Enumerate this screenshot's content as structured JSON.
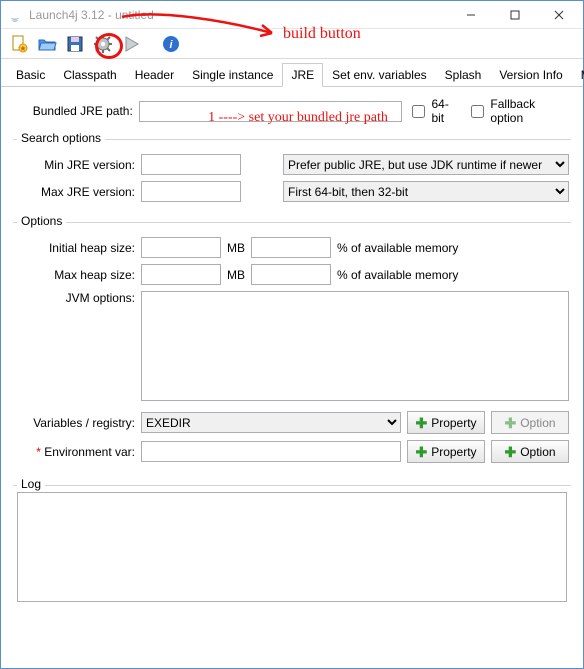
{
  "window": {
    "title": "Launch4j 3.12 - untitled"
  },
  "toolbar_icons": {
    "new": "new-file-icon",
    "open": "open-folder-icon",
    "save": "save-icon",
    "build": "gear-icon",
    "run": "play-icon",
    "info": "info-icon"
  },
  "tabs": [
    "Basic",
    "Classpath",
    "Header",
    "Single instance",
    "JRE",
    "Set env. variables",
    "Splash",
    "Version Info",
    "Messages"
  ],
  "active_tab": "JRE",
  "jre": {
    "bundled_label": "Bundled JRE path:",
    "bundled_value": "",
    "sixtyfour_label": "64-bit",
    "fallback_label": "Fallback option",
    "search_legend": "Search options",
    "min_label": "Min JRE version:",
    "min_value": "",
    "max_label": "Max JRE version:",
    "max_value": "",
    "pref_dropdown": "Prefer public JRE, but use JDK runtime if newer",
    "arch_dropdown": "First 64-bit, then 32-bit",
    "options_legend": "Options",
    "init_heap_label": "Initial heap size:",
    "init_heap_value": "",
    "init_heap_pct_value": "",
    "max_heap_label": "Max heap size:",
    "max_heap_value": "",
    "max_heap_pct_value": "",
    "mb": "MB",
    "pct_label": "% of available memory",
    "jvm_label": "JVM options:",
    "jvm_value": "",
    "vars_label": "Variables / registry:",
    "vars_value": "EXEDIR",
    "env_label": "* Environment var:",
    "env_value": "",
    "property_btn": "Property",
    "option_btn": "Option",
    "log_legend": "Log"
  },
  "annotations": {
    "build": "build button",
    "bundled": "1 ---->  set your bundled jre path"
  },
  "colors": {
    "annotation": "#e11919"
  }
}
